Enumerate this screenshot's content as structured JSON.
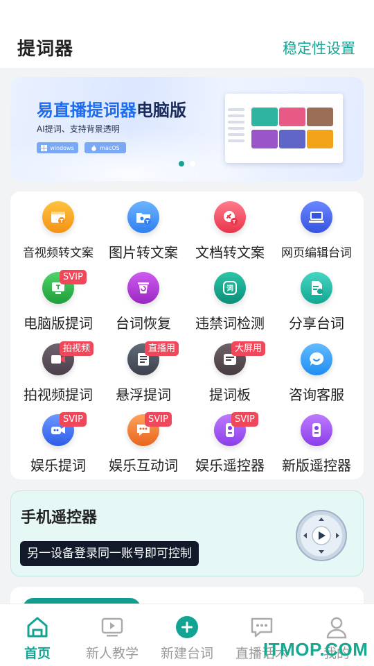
{
  "header": {
    "title": "提词器",
    "settings_link": "稳定性设置"
  },
  "banner": {
    "title_highlight": "易直播提词器",
    "title_rest": "电脑版",
    "subtitle": "AI提词、支持背景透明",
    "os_tags": [
      "windows",
      "macOS"
    ],
    "slide_count": 2,
    "active_slide": 1
  },
  "tools": [
    {
      "label": "音视频转文案",
      "icon": "video-to-text-icon",
      "color": "#f6a21e"
    },
    {
      "label": "图片转文案",
      "icon": "image-to-text-icon",
      "color": "#3e8df0"
    },
    {
      "label": "文档转文案",
      "icon": "document-to-text-icon",
      "color": "#ef4b5f"
    },
    {
      "label": "网页编辑台词",
      "icon": "web-edit-icon",
      "color": "#4363e8"
    },
    {
      "label": "电脑版提词",
      "icon": "desktop-prompter-icon",
      "color": "#29b24a",
      "tag": "SVIP"
    },
    {
      "label": "台词恢复",
      "icon": "restore-icon",
      "color": "#a839c9"
    },
    {
      "label": "违禁词检测",
      "icon": "banned-words-icon",
      "color": "#13a08b"
    },
    {
      "label": "分享台词",
      "icon": "share-icon",
      "color": "#20b8a4"
    },
    {
      "label": "拍视频提词",
      "icon": "record-video-icon",
      "color": "#5a4e5a",
      "tag": "拍视频"
    },
    {
      "label": "悬浮提词",
      "icon": "floating-prompter-icon",
      "color": "#4a5260",
      "tag": "直播用"
    },
    {
      "label": "提词板",
      "icon": "prompter-board-icon",
      "color": "#5a4e52",
      "tag": "大屏用"
    },
    {
      "label": "咨询客服",
      "icon": "customer-service-icon",
      "color": "#2f9cf0"
    },
    {
      "label": "娱乐提词",
      "icon": "fun-prompter-icon",
      "color": "#3e6df0",
      "tag": "SVIP"
    },
    {
      "label": "娱乐互动词",
      "icon": "fun-interaction-icon",
      "color": "#f07a2a",
      "tag": "SVIP"
    },
    {
      "label": "娱乐遥控器",
      "icon": "fun-remote-icon",
      "color": "#9c4cf0",
      "tag": "SVIP"
    },
    {
      "label": "新版遥控器",
      "icon": "new-remote-icon",
      "color": "#9c4cf0"
    }
  ],
  "remote": {
    "title": "手机遥控器",
    "hint": "另一设备登录同一账号即可控制"
  },
  "tabbar": [
    {
      "label": "首页",
      "icon": "home-icon",
      "active": true
    },
    {
      "label": "新人教学",
      "icon": "tutorial-icon",
      "active": false
    },
    {
      "label": "新建台词",
      "icon": "add-icon",
      "active": false
    },
    {
      "label": "直播话术",
      "icon": "chat-icon",
      "active": false
    },
    {
      "label": "我的",
      "icon": "user-icon",
      "active": false
    }
  ],
  "watermark": "ITMOP.COM",
  "colors": {
    "accent": "#13a393",
    "tag_red": "#f0475a"
  }
}
